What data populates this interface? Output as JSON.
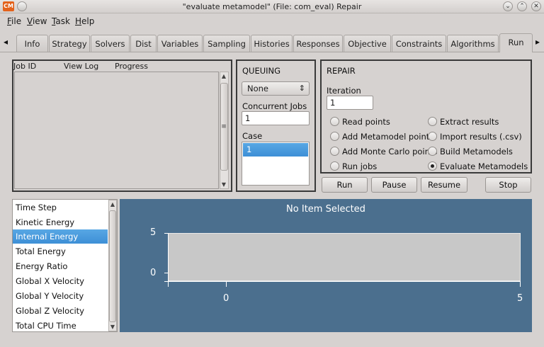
{
  "window": {
    "app_icon_text": "CM",
    "title": "\"evaluate metamodel\" (File: com_eval)   Repair"
  },
  "window_controls": {
    "minimize": "⌄",
    "maximize": "⌃",
    "close": "✕"
  },
  "menubar": [
    {
      "label": "File",
      "mnemonic": "F",
      "rest": "ile"
    },
    {
      "label": "View",
      "mnemonic": "V",
      "rest": "iew"
    },
    {
      "label": "Task",
      "mnemonic": "T",
      "rest": "ask"
    },
    {
      "label": "Help",
      "mnemonic": "H",
      "rest": "elp"
    }
  ],
  "tabs": [
    "Info",
    "Strategy",
    "Solvers",
    "Dist",
    "Variables",
    "Sampling",
    "Histories",
    "Responses",
    "Objective",
    "Constraints",
    "Algorithms",
    "Run"
  ],
  "active_tab": "Run",
  "tab_scroll": {
    "left": "◂",
    "right": "▸"
  },
  "jobs": {
    "columns": [
      "Job ID",
      "View Log",
      "Progress"
    ],
    "scroll_up": "▲",
    "scroll_down": "▼",
    "grip": "≡"
  },
  "queuing": {
    "title": "QUEUING",
    "mode_value": "None",
    "combo_arrow": "⇕",
    "concurrent_label": "Concurrent Jobs",
    "concurrent_value": "1",
    "case_label": "Case",
    "case_items": [
      "1"
    ]
  },
  "repair": {
    "title": "REPAIR",
    "iteration_label": "Iteration",
    "iteration_value": "1",
    "options_left": [
      "Read points",
      "Add Metamodel points",
      "Add Monte Carlo points",
      "Run jobs"
    ],
    "options_right": [
      "Extract results",
      "Import results (.csv)",
      "Build Metamodels",
      "Evaluate Metamodels"
    ],
    "selected": "Evaluate Metamodels"
  },
  "buttons": {
    "run": "Run",
    "pause": "Pause",
    "resume": "Resume",
    "stop": "Stop"
  },
  "variables": {
    "items": [
      "Time Step",
      "Kinetic Energy",
      "Internal Energy",
      "Total Energy",
      "Energy Ratio",
      "Global X Velocity",
      "Global Y Velocity",
      "Global Z Velocity",
      "Total CPU Time"
    ],
    "selected": "Internal Energy",
    "scroll_up": "▲",
    "scroll_down": "▼"
  },
  "plot": {
    "title": "No Item Selected",
    "y_ticks": [
      "5",
      "0"
    ],
    "x_ticks": [
      "0",
      "5"
    ],
    "background": "#4b6f8e"
  }
}
